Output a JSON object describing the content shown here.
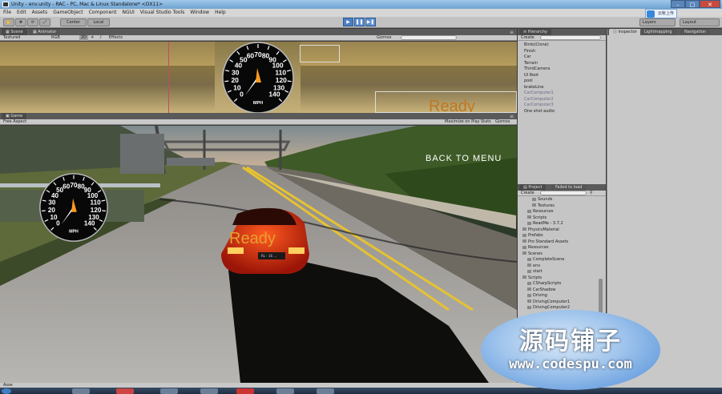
{
  "window": {
    "title": "Unity - env.unity - RAC - PC, Mac & Linux Standalone* <DX11>"
  },
  "menu": [
    "File",
    "Edit",
    "Assets",
    "GameObject",
    "Component",
    "NGUI",
    "Visual Studio Tools",
    "Window",
    "Help"
  ],
  "toolbar": {
    "pivot": "Center",
    "space": "Local",
    "layers": "Layers",
    "layout": "Layout",
    "cloud": "云帐上传"
  },
  "scene_panel": {
    "tab_scene": "Scene",
    "tab_animator": "Animator",
    "shading": "Textured",
    "render_mode": "RGB",
    "mode_2d": "2D",
    "effects": "Effects",
    "gizmos": "Gizmos",
    "ready_text": "Ready"
  },
  "game_panel": {
    "tab_game": "Game",
    "aspect": "Free Aspect",
    "maximize": "Maximize on Play",
    "stats": "Stats",
    "gizmos": "Gizmos",
    "back_to_menu": "BACK TO MENU",
    "ready_text": "Ready",
    "plate": "RL - 16 ..."
  },
  "speedometer": {
    "ticks": [
      "0",
      "10",
      "20",
      "30",
      "40",
      "50",
      "60",
      "70",
      "80",
      "90",
      "100",
      "110",
      "120",
      "130",
      "140"
    ],
    "unit": "MPH"
  },
  "hierarchy": {
    "tab": "Hierarchy",
    "create": "Create",
    "items": [
      {
        "label": "Birds(Clone)",
        "dim": false
      },
      {
        "label": "Finish",
        "dim": false
      },
      {
        "label": "Car",
        "dim": false
      },
      {
        "label": "Terrain",
        "dim": false
      },
      {
        "label": "ThirdCamera",
        "dim": false
      },
      {
        "label": "UI Root",
        "dim": false
      },
      {
        "label": "pool",
        "dim": false
      },
      {
        "label": "brakeLine",
        "dim": false
      },
      {
        "label": "CarComputer1",
        "dim": true
      },
      {
        "label": "CarComputer2",
        "dim": true
      },
      {
        "label": "CarComputer3",
        "dim": true
      },
      {
        "label": "One shot audio",
        "dim": false
      }
    ]
  },
  "project": {
    "tab": "Project",
    "tab2": "Failed to load",
    "create": "Create",
    "items": [
      {
        "label": "Sounds",
        "indent": 2
      },
      {
        "label": "Textures",
        "indent": 2
      },
      {
        "label": "Resources",
        "indent": 1
      },
      {
        "label": "Scripts",
        "indent": 1
      },
      {
        "label": "ReadMe - 3.7.2",
        "indent": 1
      },
      {
        "label": "PhysicsMaterial",
        "indent": 0
      },
      {
        "label": "Prefabs",
        "indent": 0
      },
      {
        "label": "Pro Standard Assets",
        "indent": 0
      },
      {
        "label": "Resources",
        "indent": 0
      },
      {
        "label": "Scenes",
        "indent": 0
      },
      {
        "label": "CompleteScene",
        "indent": 1
      },
      {
        "label": "env",
        "indent": 1
      },
      {
        "label": "start",
        "indent": 1
      },
      {
        "label": "Scripts",
        "indent": 0
      },
      {
        "label": "CSharpScripts",
        "indent": 1
      },
      {
        "label": "CarShadow",
        "indent": 1
      },
      {
        "label": "Driving",
        "indent": 1
      },
      {
        "label": "DrivingComputer1",
        "indent": 1
      },
      {
        "label": "DrivingComputer2",
        "indent": 1
      }
    ]
  },
  "inspector": {
    "tab": "Inspector",
    "tab2": "Lightmapping",
    "tab3": "Navigation"
  },
  "status": {
    "text": "Asse"
  },
  "watermark": {
    "line1": "源码铺子",
    "line2": "www.codespu.com"
  }
}
